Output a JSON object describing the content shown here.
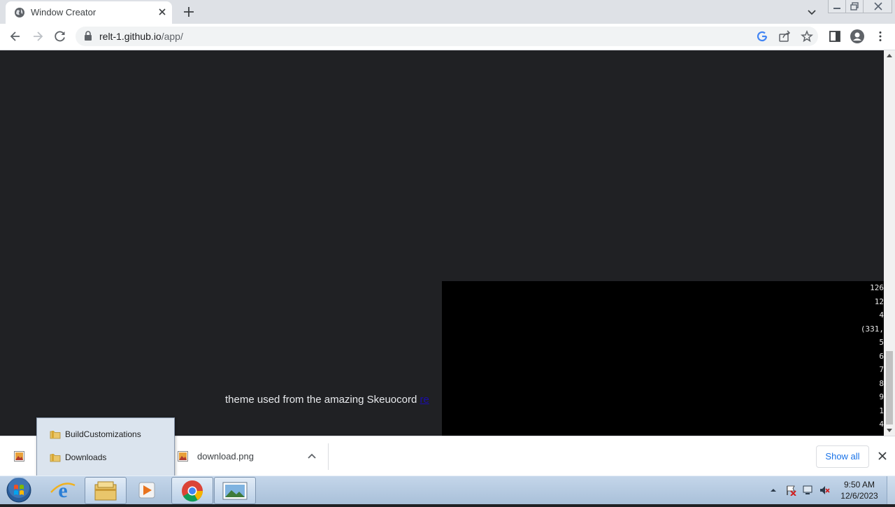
{
  "browser": {
    "tab_title": "Window Creator",
    "url_host": "relt-1.github.io",
    "url_path": "/app/"
  },
  "page": {
    "credit_text": "theme used from the amazing Skeuocord ",
    "credit_link": "re",
    "console_lines": [
      "126",
      "12",
      "4",
      "(331,",
      "5",
      "6",
      "7",
      "8",
      "9",
      "1",
      "4"
    ]
  },
  "downloads": {
    "file_name": "download.png",
    "show_all_label": "Show all"
  },
  "jumplist": {
    "items": [
      {
        "label": "BuildCustomizations",
        "icon": "folder-icon"
      },
      {
        "label": "Downloads",
        "icon": "folder-icon"
      }
    ]
  },
  "taskbar": {
    "time": "9:50 AM",
    "date": "12/6/2023",
    "apps": [
      "internet-explorer",
      "file-explorer",
      "media-player",
      "chrome",
      "image-viewer"
    ]
  },
  "colors": {
    "page_bg": "#202124",
    "link": "#1a0dab",
    "accent": "#1a73e8"
  }
}
